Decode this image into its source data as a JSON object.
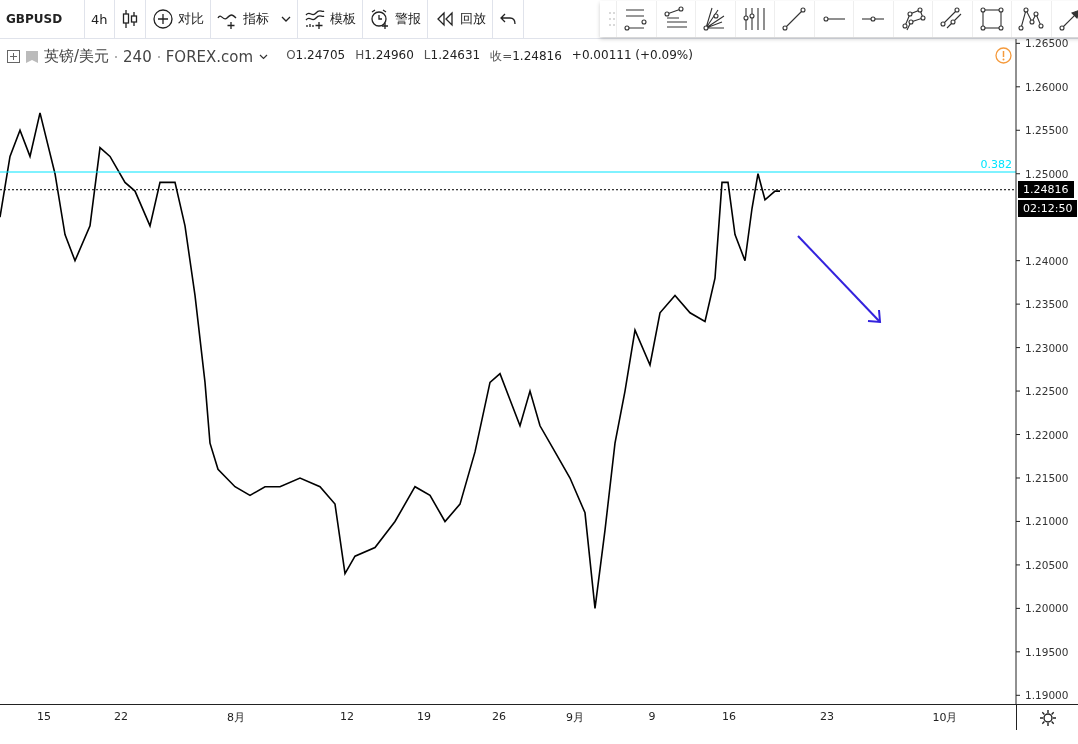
{
  "toolbar": {
    "symbol": "GBPUSD",
    "interval": "4h",
    "buttons": [
      {
        "label": "对比"
      },
      {
        "label": "指标",
        "dropdown": true
      },
      {
        "label": "模板"
      },
      {
        "label": "警报"
      },
      {
        "label": "回放"
      }
    ]
  },
  "legend": {
    "symbol": "英镑/美元",
    "interval": "240",
    "exchange": "FOREX.com",
    "ohlc": [
      {
        "label": "O",
        "value": "1.24705"
      },
      {
        "label": "H",
        "value": "1.24960"
      },
      {
        "label": "L",
        "value": "1.24631"
      },
      {
        "label": "收=",
        "value": "1.24816"
      }
    ],
    "change": "+0.00111 (+0.09%)"
  },
  "price_axis_labels": [
    "1.26500",
    "1.26000",
    "1.25500",
    "1.25000",
    "1.24000",
    "1.23500",
    "1.23000",
    "1.22500",
    "1.22000",
    "1.21500",
    "1.21000",
    "1.20500",
    "1.20000",
    "1.19500",
    "1.19000"
  ],
  "fib_level": {
    "label": "0.382"
  },
  "price_tag": "1.24816",
  "countdown": "02:12:50",
  "x_axis_labels": [
    "15",
    "22",
    "8月",
    "12",
    "19",
    "26",
    "9月",
    "9",
    "16",
    "23",
    "10月"
  ]
}
